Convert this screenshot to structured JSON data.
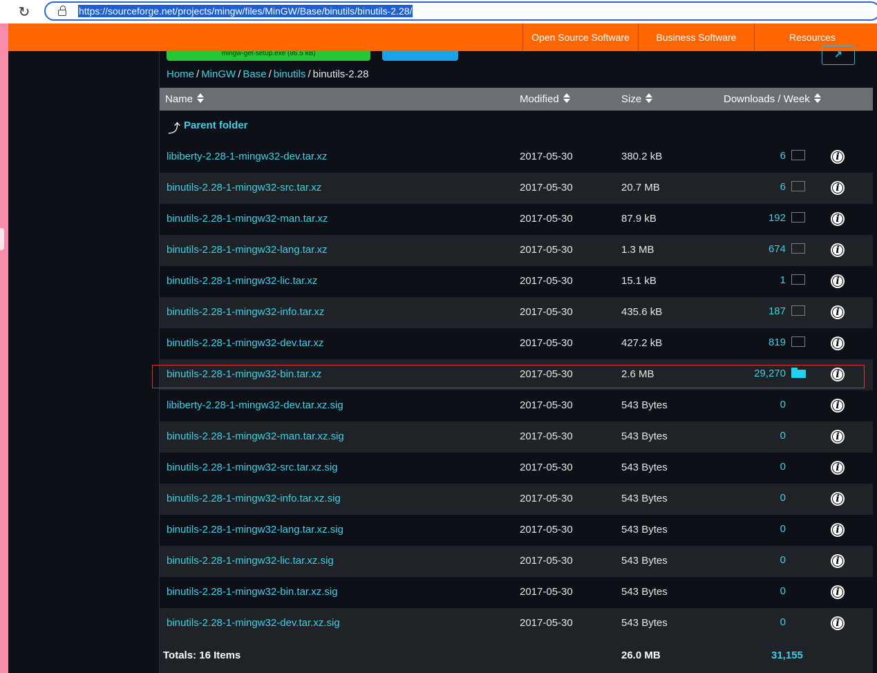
{
  "browser": {
    "url": "https://sourceforge.net/projects/mingw/files/MinGW/Base/binutils/binutils-2.28/"
  },
  "nav": {
    "items": [
      "Open Source Software",
      "Business Software",
      "Resources"
    ]
  },
  "top_buttons": {
    "download_label": "mingw-get-setup.exe (86.5 kB)"
  },
  "breadcrumb": {
    "items": [
      "Home",
      "MinGW",
      "Base",
      "binutils"
    ],
    "current": "binutils-2.28",
    "separator": "/"
  },
  "table": {
    "headers": {
      "name": "Name",
      "modified": "Modified",
      "size": "Size",
      "downloads": "Downloads / Week"
    },
    "parent_label": "Parent folder",
    "rows": [
      {
        "name": "libiberty-2.28-1-mingw32-dev.tar.xz",
        "modified": "2017-05-30",
        "size": "380.2 kB",
        "downloads": "6",
        "chart": "empty"
      },
      {
        "name": "binutils-2.28-1-mingw32-src.tar.xz",
        "modified": "2017-05-30",
        "size": "20.7 MB",
        "downloads": "6",
        "chart": "empty"
      },
      {
        "name": "binutils-2.28-1-mingw32-man.tar.xz",
        "modified": "2017-05-30",
        "size": "87.9 kB",
        "downloads": "192",
        "chart": "empty"
      },
      {
        "name": "binutils-2.28-1-mingw32-lang.tar.xz",
        "modified": "2017-05-30",
        "size": "1.3 MB",
        "downloads": "674",
        "chart": "empty"
      },
      {
        "name": "binutils-2.28-1-mingw32-lic.tar.xz",
        "modified": "2017-05-30",
        "size": "15.1 kB",
        "downloads": "1",
        "chart": "empty"
      },
      {
        "name": "binutils-2.28-1-mingw32-info.tar.xz",
        "modified": "2017-05-30",
        "size": "435.6 kB",
        "downloads": "187",
        "chart": "empty"
      },
      {
        "name": "binutils-2.28-1-mingw32-dev.tar.xz",
        "modified": "2017-05-30",
        "size": "427.2 kB",
        "downloads": "819",
        "chart": "empty"
      },
      {
        "name": "binutils-2.28-1-mingw32-bin.tar.xz",
        "modified": "2017-05-30",
        "size": "2.6 MB",
        "downloads": "29,270",
        "chart": "folder"
      },
      {
        "name": "libiberty-2.28-1-mingw32-dev.tar.xz.sig",
        "modified": "2017-05-30",
        "size": "543 Bytes",
        "downloads": "0",
        "chart": "none"
      },
      {
        "name": "binutils-2.28-1-mingw32-man.tar.xz.sig",
        "modified": "2017-05-30",
        "size": "543 Bytes",
        "downloads": "0",
        "chart": "none"
      },
      {
        "name": "binutils-2.28-1-mingw32-src.tar.xz.sig",
        "modified": "2017-05-30",
        "size": "543 Bytes",
        "downloads": "0",
        "chart": "none"
      },
      {
        "name": "binutils-2.28-1-mingw32-info.tar.xz.sig",
        "modified": "2017-05-30",
        "size": "543 Bytes",
        "downloads": "0",
        "chart": "none"
      },
      {
        "name": "binutils-2.28-1-mingw32-lang.tar.xz.sig",
        "modified": "2017-05-30",
        "size": "543 Bytes",
        "downloads": "0",
        "chart": "none"
      },
      {
        "name": "binutils-2.28-1-mingw32-lic.tar.xz.sig",
        "modified": "2017-05-30",
        "size": "543 Bytes",
        "downloads": "0",
        "chart": "none"
      },
      {
        "name": "binutils-2.28-1-mingw32-bin.tar.xz.sig",
        "modified": "2017-05-30",
        "size": "543 Bytes",
        "downloads": "0",
        "chart": "none"
      },
      {
        "name": "binutils-2.28-1-mingw32-dev.tar.xz.sig",
        "modified": "2017-05-30",
        "size": "543 Bytes",
        "downloads": "0",
        "chart": "none"
      }
    ],
    "totals": {
      "label": "Totals: 16 Items",
      "size": "26.0 MB",
      "downloads": "31,155"
    }
  },
  "colors": {
    "accent": "#ff6600",
    "link": "#3fd0e6",
    "highlight": "#e0322c"
  },
  "icons": {
    "reload": "reload-icon",
    "lock": "lock-icon",
    "info": "info-icon",
    "parent": "parent-folder-arrow-icon",
    "sort": "sort-icon"
  }
}
